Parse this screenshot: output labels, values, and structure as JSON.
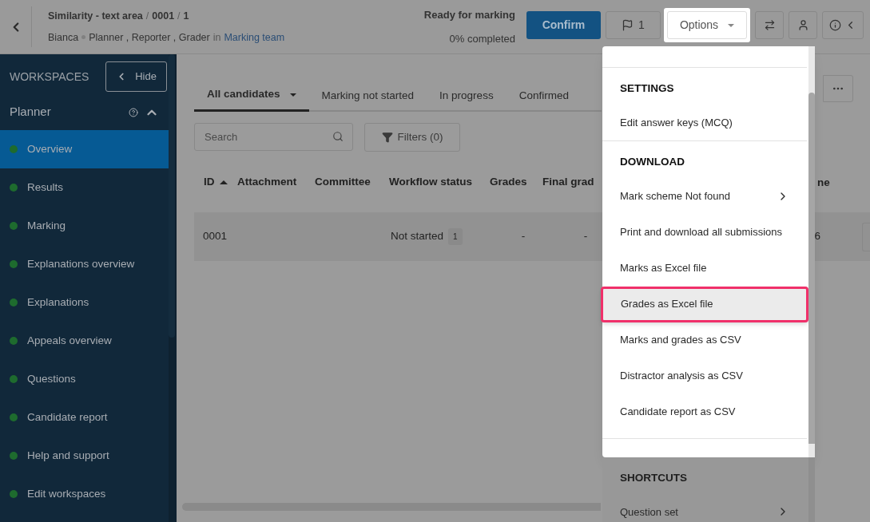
{
  "header": {
    "breadcrumb": [
      "Similarity - text area",
      "0001",
      "1"
    ],
    "separator": "/",
    "user": "Bianca",
    "roles": "Planner , Reporter , Grader",
    "connector": "in",
    "team": "Marking team",
    "status": "Ready for marking",
    "progress": "0% completed",
    "confirm": "Confirm",
    "flags": "1",
    "options": "Options"
  },
  "sidebar": {
    "title": "WORKSPACES",
    "hide": "Hide",
    "section": "Planner",
    "expanded": true,
    "items": [
      {
        "label": "Overview",
        "selected": true,
        "color": "#1e6b2e"
      },
      {
        "label": "Results",
        "selected": false,
        "color": "#1e6b2e"
      },
      {
        "label": "Marking",
        "selected": false,
        "color": "#1e6b2e"
      },
      {
        "label": "Explanations overview",
        "selected": false,
        "color": "#1e6b2e"
      },
      {
        "label": "Explanations",
        "selected": false,
        "color": "#1e6b2e"
      },
      {
        "label": "Appeals overview",
        "selected": false,
        "color": "#1e6b2e"
      },
      {
        "label": "Questions",
        "selected": false,
        "color": "#1e6b2e"
      },
      {
        "label": "Candidate report",
        "selected": false,
        "color": "#1e6b2e"
      },
      {
        "label": "Help and support",
        "selected": false,
        "color": "#1e6b2e"
      },
      {
        "label": "Edit workspaces",
        "selected": false,
        "color": "#1e6b2e"
      }
    ]
  },
  "tabs": [
    {
      "label": "All candidates",
      "selected": true
    },
    {
      "label": "Marking not started",
      "selected": false
    },
    {
      "label": "In progress",
      "selected": false
    },
    {
      "label": "Confirmed",
      "selected": false
    }
  ],
  "search": {
    "placeholder": "Search"
  },
  "filters": "Filters (0)",
  "table": {
    "columns": [
      {
        "label": "ID",
        "sorted": true
      },
      {
        "label": "Attachment",
        "sorted": false
      },
      {
        "label": "Committee",
        "sorted": false
      },
      {
        "label": "Workflow status",
        "sorted": false
      },
      {
        "label": "Grades",
        "sorted": false
      },
      {
        "label": "Final grad",
        "sorted": false
      }
    ],
    "column_7": "ne",
    "rows": [
      {
        "id": "0001",
        "status": "Not started",
        "badge": "1",
        "grades": "-",
        "final": "-",
        "column_7": "6"
      }
    ]
  },
  "menu": {
    "sections": [
      {
        "title": "SETTINGS",
        "dimmed": false,
        "items": [
          {
            "label": "Edit answer keys (MCQ)",
            "selected": false,
            "submenu": false
          }
        ]
      },
      {
        "title": "DOWNLOAD",
        "dimmed": false,
        "items": [
          {
            "label": "Mark scheme Not found",
            "selected": false,
            "submenu": true
          },
          {
            "label": "Print and download all submissions",
            "selected": false,
            "submenu": false
          },
          {
            "label": "Marks as Excel file",
            "selected": false,
            "submenu": false
          },
          {
            "label": "Grades as Excel file",
            "selected": true,
            "submenu": false
          },
          {
            "label": "Marks and grades as CSV",
            "selected": false,
            "submenu": false
          },
          {
            "label": "Distractor analysis as CSV",
            "selected": false,
            "submenu": false
          },
          {
            "label": "Candidate report as CSV",
            "selected": false,
            "submenu": false
          }
        ]
      },
      {
        "title": "SHORTCUTS",
        "dimmed": true,
        "items": [
          {
            "label": "Question set",
            "selected": false,
            "submenu": true
          }
        ]
      }
    ]
  }
}
